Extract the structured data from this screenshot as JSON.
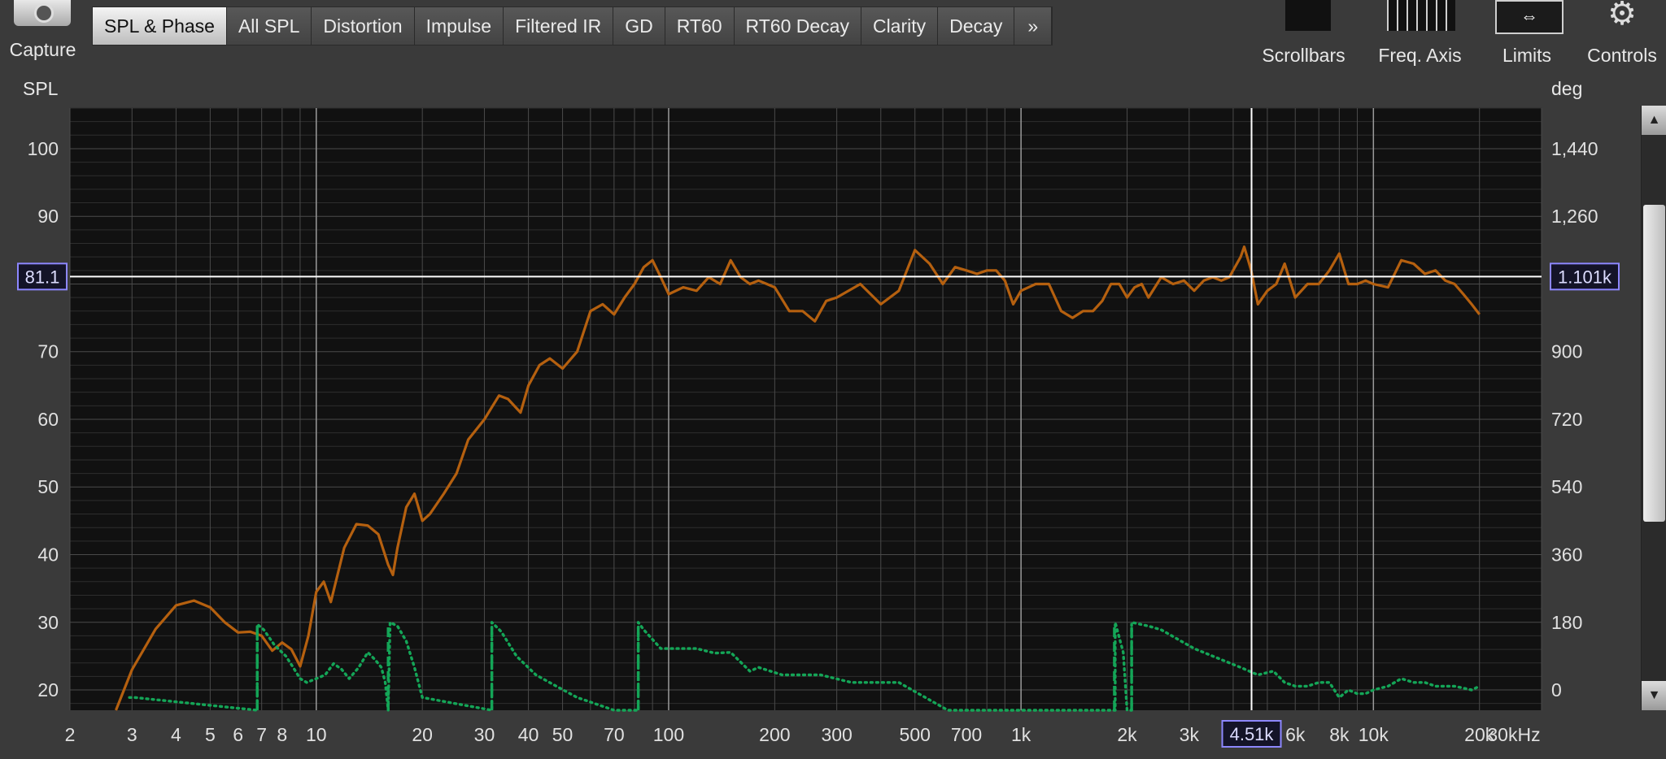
{
  "toolbar": {
    "capture_label": "Capture",
    "tabs": [
      {
        "label": "SPL & Phase",
        "active": true
      },
      {
        "label": "All SPL"
      },
      {
        "label": "Distortion"
      },
      {
        "label": "Impulse"
      },
      {
        "label": "Filtered IR"
      },
      {
        "label": "GD"
      },
      {
        "label": "RT60"
      },
      {
        "label": "RT60 Decay"
      },
      {
        "label": "Clarity"
      },
      {
        "label": "Decay"
      }
    ],
    "more_label": "»",
    "tools": {
      "scrollbars": "Scrollbars",
      "freq_axis": "Freq. Axis",
      "limits": "Limits",
      "controls": "Controls"
    }
  },
  "icons": {
    "capture": "camera-icon",
    "scrollbars": "scrollbars-icon",
    "freq_axis": "frequency-axis-icon",
    "limits": "limits-arrows-icon",
    "controls": "gear-icon"
  },
  "colors": {
    "plot_bg": "#111111",
    "spl_trace": "#b5600f",
    "phase_trace": "#14a557",
    "cursor": "#ffffff",
    "readout_border": "#8d87ff"
  },
  "cursor": {
    "spl_readout": "81.1",
    "phase_readout": "1.101k",
    "freq_readout": "4.51k",
    "freq_hz": 4510,
    "spl_db": 81.1
  },
  "chart_data": {
    "type": "line",
    "xlabel": "kHz",
    "ylabel": "SPL",
    "y2label": "deg",
    "x_scale": "log",
    "xlim": [
      2,
      30000
    ],
    "ylim": [
      17,
      106
    ],
    "y2lim": [
      -54,
      1548
    ],
    "grid": true,
    "x_tick_labels": [
      {
        "x": 2,
        "label": "2"
      },
      {
        "x": 3,
        "label": "3"
      },
      {
        "x": 4,
        "label": "4"
      },
      {
        "x": 5,
        "label": "5"
      },
      {
        "x": 6,
        "label": "6"
      },
      {
        "x": 7,
        "label": "7"
      },
      {
        "x": 8,
        "label": "8"
      },
      {
        "x": 10,
        "label": "10"
      },
      {
        "x": 20,
        "label": "20"
      },
      {
        "x": 30,
        "label": "30"
      },
      {
        "x": 40,
        "label": "40"
      },
      {
        "x": 50,
        "label": "50"
      },
      {
        "x": 70,
        "label": "70"
      },
      {
        "x": 100,
        "label": "100"
      },
      {
        "x": 200,
        "label": "200"
      },
      {
        "x": 300,
        "label": "300"
      },
      {
        "x": 500,
        "label": "500"
      },
      {
        "x": 700,
        "label": "700"
      },
      {
        "x": 1000,
        "label": "1k"
      },
      {
        "x": 2000,
        "label": "2k"
      },
      {
        "x": 3000,
        "label": "3k"
      },
      {
        "x": 6000,
        "label": "6k"
      },
      {
        "x": 8000,
        "label": "8k"
      },
      {
        "x": 10000,
        "label": "10k"
      },
      {
        "x": 20000,
        "label": "20k"
      },
      {
        "x": 30000,
        "label": "30kHz"
      }
    ],
    "y_ticks": [
      20,
      30,
      40,
      50,
      60,
      70,
      80,
      90,
      100
    ],
    "y_tick_labels": [
      "20",
      "30",
      "40",
      "50",
      "60",
      "70",
      "",
      "90",
      "100"
    ],
    "y2_ticks": [
      0,
      180,
      360,
      540,
      720,
      900,
      1080,
      1260,
      1440
    ],
    "y2_tick_labels": [
      "0",
      "180",
      "360",
      "540",
      "720",
      "900",
      "",
      "1,260",
      "1,440"
    ],
    "series": [
      {
        "axis": "left",
        "style": "solid",
        "points": [
          [
            2.7,
            17
          ],
          [
            3,
            23
          ],
          [
            3.5,
            29
          ],
          [
            4,
            32.5
          ],
          [
            4.5,
            33.2
          ],
          [
            5,
            32.2
          ],
          [
            5.5,
            30
          ],
          [
            6,
            28.5
          ],
          [
            6.5,
            28.6
          ],
          [
            7,
            28
          ],
          [
            7.5,
            25.8
          ],
          [
            8,
            27
          ],
          [
            8.5,
            26
          ],
          [
            9,
            23.5
          ],
          [
            9.5,
            28
          ],
          [
            10,
            34.5
          ],
          [
            10.5,
            36
          ],
          [
            11,
            33
          ],
          [
            12,
            41
          ],
          [
            13,
            44.5
          ],
          [
            14,
            44.3
          ],
          [
            15,
            43
          ],
          [
            16,
            38.5
          ],
          [
            16.5,
            37
          ],
          [
            17,
            41
          ],
          [
            18,
            47
          ],
          [
            19,
            49
          ],
          [
            20,
            45
          ],
          [
            21,
            46
          ],
          [
            23,
            49
          ],
          [
            25,
            52
          ],
          [
            27,
            57
          ],
          [
            30,
            60
          ],
          [
            33,
            63.5
          ],
          [
            35,
            63
          ],
          [
            38,
            61
          ],
          [
            40,
            65
          ],
          [
            43,
            68
          ],
          [
            46,
            69
          ],
          [
            50,
            67.5
          ],
          [
            55,
            70
          ],
          [
            60,
            76
          ],
          [
            65,
            77
          ],
          [
            70,
            75.5
          ],
          [
            75,
            78
          ],
          [
            80,
            80
          ],
          [
            85,
            82.5
          ],
          [
            90,
            83.5
          ],
          [
            95,
            81
          ],
          [
            100,
            78.5
          ],
          [
            110,
            79.5
          ],
          [
            120,
            79
          ],
          [
            130,
            81
          ],
          [
            140,
            80
          ],
          [
            150,
            83.5
          ],
          [
            160,
            81
          ],
          [
            170,
            80
          ],
          [
            180,
            80.5
          ],
          [
            190,
            80
          ],
          [
            200,
            79.5
          ],
          [
            220,
            76
          ],
          [
            240,
            76
          ],
          [
            260,
            74.5
          ],
          [
            280,
            77.5
          ],
          [
            300,
            78
          ],
          [
            350,
            80
          ],
          [
            400,
            77
          ],
          [
            450,
            79
          ],
          [
            500,
            85
          ],
          [
            550,
            83
          ],
          [
            600,
            80
          ],
          [
            650,
            82.5
          ],
          [
            700,
            82
          ],
          [
            750,
            81.5
          ],
          [
            800,
            82
          ],
          [
            850,
            82
          ],
          [
            900,
            80.5
          ],
          [
            950,
            77
          ],
          [
            1000,
            79
          ],
          [
            1100,
            80
          ],
          [
            1200,
            80
          ],
          [
            1300,
            76
          ],
          [
            1400,
            75
          ],
          [
            1500,
            76
          ],
          [
            1600,
            76
          ],
          [
            1700,
            77.5
          ],
          [
            1800,
            80
          ],
          [
            1900,
            80
          ],
          [
            2000,
            78
          ],
          [
            2100,
            79.5
          ],
          [
            2200,
            80
          ],
          [
            2300,
            78
          ],
          [
            2500,
            81
          ],
          [
            2700,
            80
          ],
          [
            2900,
            80.5
          ],
          [
            3100,
            79
          ],
          [
            3300,
            80.5
          ],
          [
            3500,
            81
          ],
          [
            3700,
            80.5
          ],
          [
            3900,
            81
          ],
          [
            4200,
            84
          ],
          [
            4300,
            85.5
          ],
          [
            4500,
            82
          ],
          [
            4700,
            77
          ],
          [
            5000,
            79
          ],
          [
            5300,
            80
          ],
          [
            5600,
            83
          ],
          [
            6000,
            78
          ],
          [
            6500,
            80
          ],
          [
            7000,
            80
          ],
          [
            7500,
            82
          ],
          [
            8000,
            84.5
          ],
          [
            8500,
            80
          ],
          [
            9000,
            80
          ],
          [
            9500,
            80.5
          ],
          [
            10000,
            80
          ],
          [
            11000,
            79.5
          ],
          [
            12000,
            83.5
          ],
          [
            13000,
            83
          ],
          [
            14000,
            81.5
          ],
          [
            15000,
            82
          ],
          [
            16000,
            80.5
          ],
          [
            17000,
            80
          ],
          [
            18000,
            78.5
          ],
          [
            19000,
            77
          ],
          [
            20000,
            75.5
          ]
        ]
      },
      {
        "axis": "right",
        "style": "dotted",
        "points": [
          [
            2.95,
            -20
          ],
          [
            3.05,
            -20
          ],
          [
            6.8,
            -54
          ],
          [
            6.8,
            175
          ],
          [
            7.1,
            160
          ],
          [
            7.6,
            120
          ],
          [
            8.2,
            90
          ],
          [
            8.6,
            60
          ],
          [
            9.0,
            30
          ],
          [
            9.4,
            20
          ],
          [
            10.0,
            30
          ],
          [
            10.6,
            40
          ],
          [
            11.2,
            70
          ],
          [
            11.8,
            55
          ],
          [
            12.4,
            30
          ],
          [
            13.2,
            60
          ],
          [
            14.0,
            100
          ],
          [
            14.7,
            80
          ],
          [
            15.3,
            60
          ],
          [
            15.7,
            20
          ],
          [
            16.0,
            -54
          ],
          [
            16.2,
            180
          ],
          [
            17.0,
            170
          ],
          [
            18.0,
            130
          ],
          [
            19.0,
            60
          ],
          [
            20.0,
            -20
          ],
          [
            31.5,
            -54
          ],
          [
            31.5,
            180
          ],
          [
            33.5,
            155
          ],
          [
            37.0,
            90
          ],
          [
            42.0,
            40
          ],
          [
            48.0,
            10
          ],
          [
            55.0,
            -20
          ],
          [
            70.0,
            -54
          ],
          [
            82.0,
            -54
          ],
          [
            82.0,
            180
          ],
          [
            85.0,
            160
          ],
          [
            95.0,
            110
          ],
          [
            120.0,
            110
          ],
          [
            135.0,
            98
          ],
          [
            150.0,
            100
          ],
          [
            170.0,
            50
          ],
          [
            180.0,
            60
          ],
          [
            210.0,
            40
          ],
          [
            270.0,
            40
          ],
          [
            330.0,
            20
          ],
          [
            450.0,
            20
          ],
          [
            620.0,
            -54
          ],
          [
            1850.0,
            -54
          ],
          [
            1850.0,
            180
          ],
          [
            1950.0,
            100
          ],
          [
            2000.0,
            -54
          ],
          [
            2060.0,
            -54
          ],
          [
            2060.0,
            180
          ],
          [
            2300.0,
            170
          ],
          [
            2500.0,
            160
          ],
          [
            3100.0,
            110
          ],
          [
            3500.0,
            90
          ],
          [
            4200.0,
            60
          ],
          [
            4700.0,
            40
          ],
          [
            5200.0,
            50
          ],
          [
            5600.0,
            20
          ],
          [
            6000.0,
            10
          ],
          [
            6500.0,
            10
          ],
          [
            7000.0,
            20
          ],
          [
            7500.0,
            20
          ],
          [
            8000.0,
            -20
          ],
          [
            8500.0,
            0
          ],
          [
            9000.0,
            -10
          ],
          [
            9500.0,
            -10
          ],
          [
            10000.0,
            0
          ],
          [
            11000.0,
            10
          ],
          [
            12000.0,
            30
          ],
          [
            13000.0,
            20
          ],
          [
            14000.0,
            20
          ],
          [
            15000.0,
            10
          ],
          [
            17000.0,
            10
          ],
          [
            19000.0,
            0
          ],
          [
            20000.0,
            10
          ]
        ]
      },
      {
        "axis": "right",
        "style": "dashed",
        "points": [
          [
            6.8,
            -54
          ],
          [
            6.8,
            175
          ]
        ]
      },
      {
        "axis": "right",
        "style": "dashed",
        "points": [
          [
            16.0,
            -54
          ],
          [
            16.0,
            180
          ]
        ]
      },
      {
        "axis": "right",
        "style": "dashed",
        "points": [
          [
            31.5,
            -54
          ],
          [
            31.5,
            180
          ]
        ]
      },
      {
        "axis": "right",
        "style": "dashed",
        "points": [
          [
            82.0,
            -54
          ],
          [
            82.0,
            180
          ]
        ]
      },
      {
        "axis": "right",
        "style": "dashed",
        "points": [
          [
            1840.0,
            -54
          ],
          [
            1840.0,
            180
          ]
        ]
      },
      {
        "axis": "right",
        "style": "dashed",
        "points": [
          [
            2060.0,
            -54
          ],
          [
            2060.0,
            180
          ]
        ]
      }
    ]
  }
}
